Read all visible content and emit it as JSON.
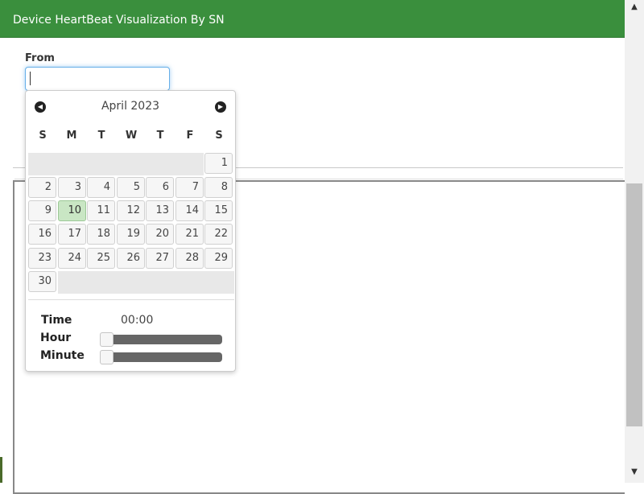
{
  "header": {
    "title": "Device HeartBeat Visualization By SN"
  },
  "form": {
    "from_label": "From",
    "from_value": ""
  },
  "datepicker": {
    "month_title": "April 2023",
    "prev_icon": "chevron-left-circle-icon",
    "next_icon": "chevron-right-circle-icon",
    "weekdays": [
      "S",
      "M",
      "T",
      "W",
      "T",
      "F",
      "S"
    ],
    "days": [
      "1",
      "2",
      "3",
      "4",
      "5",
      "6",
      "7",
      "8",
      "9",
      "10",
      "11",
      "12",
      "13",
      "14",
      "15",
      "16",
      "17",
      "18",
      "19",
      "20",
      "21",
      "22",
      "23",
      "24",
      "25",
      "26",
      "27",
      "28",
      "29",
      "30"
    ],
    "today": "10",
    "time_label": "Time",
    "time_value": "00:00",
    "hour_label": "Hour",
    "minute_label": "Minute",
    "hour_value": 0,
    "minute_value": 0
  },
  "colors": {
    "header_bg": "#3a8f3d",
    "today_bg": "#c9e6c4",
    "slider_track": "#666666"
  }
}
